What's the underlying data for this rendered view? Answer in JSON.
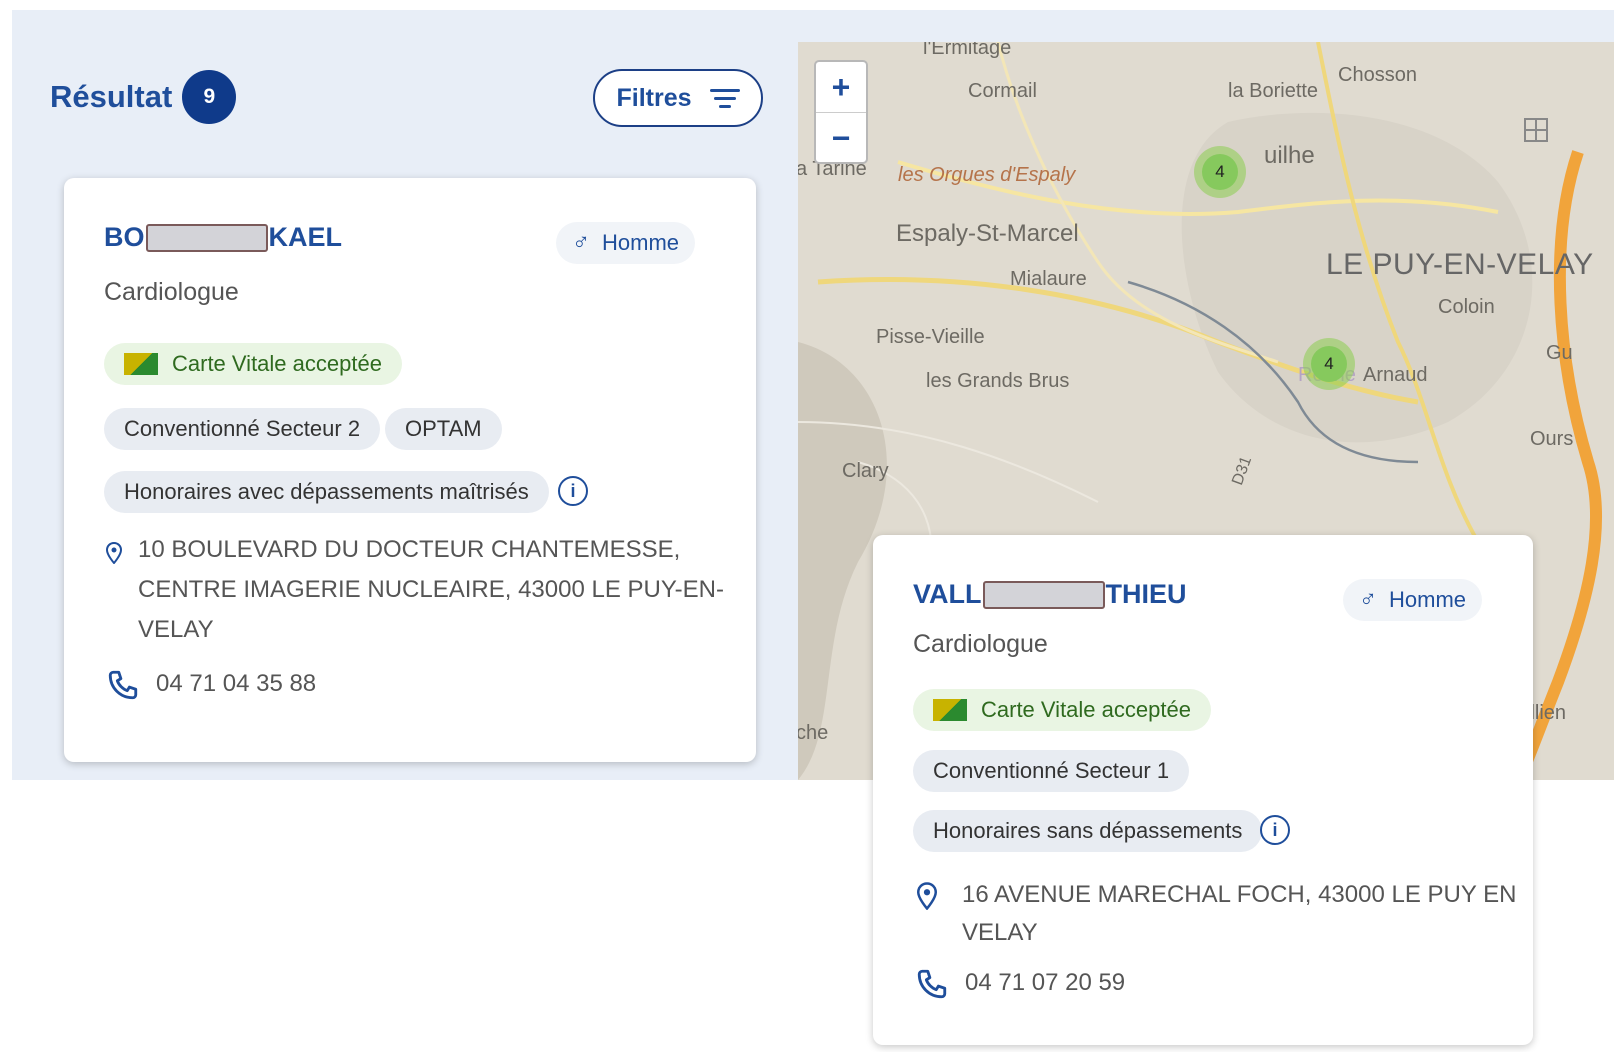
{
  "results": {
    "title": "Résultat",
    "count": "9"
  },
  "filters": {
    "label": "Filtres"
  },
  "map": {
    "zoom_in": "+",
    "zoom_out": "−",
    "labels": {
      "ermitage": "l'Ermitage",
      "cormail": "Cormail",
      "boriette": "la Boriette",
      "chosson": "Chosson",
      "tarine": "a Tarine",
      "orgues": "les Orgues d'Espaly",
      "aiguilhe": "uilhe",
      "espaly": "Espaly-St-Marcel",
      "mialaure": "Mialaure",
      "lepuy": "LE PUY-EN-VELAY",
      "coloin": "Coloin",
      "pisse": "Pisse-Vieille",
      "grands_brus": "les Grands Brus",
      "arnaud": "Arnaud",
      "roche": "Roche",
      "clary": "Clary",
      "ours": "Ours",
      "gu": "Gu",
      "d031": "D31",
      "salliens": "Sallien",
      "che": "che"
    },
    "clusters": [
      "4",
      "4"
    ]
  },
  "cards": [
    {
      "name_start": "BO",
      "name_end": "KAEL",
      "gender": "Homme",
      "specialty": "Cardiologue",
      "vitale": "Carte Vitale acceptée",
      "sector": "Conventionné Secteur 2",
      "optam": "OPTAM",
      "fees": "Honoraires avec dépassements maîtrisés",
      "address_l1": "10 BOULEVARD DU DOCTEUR CHANTEMESSE,",
      "address_l2": "CENTRE IMAGERIE NUCLEAIRE, 43000 LE PUY-EN-",
      "address_l3": "VELAY",
      "phone": "04 71 04 35 88"
    },
    {
      "name_start": "VALL",
      "name_end": "THIEU",
      "gender": "Homme",
      "specialty": "Cardiologue",
      "vitale": "Carte Vitale acceptée",
      "sector": "Conventionné Secteur 1",
      "fees": "Honoraires sans dépassements",
      "address_l1": "16 AVENUE MARECHAL FOCH, 43000 LE PUY EN",
      "address_l2": "VELAY",
      "phone": "04 71 07 20 59"
    }
  ]
}
